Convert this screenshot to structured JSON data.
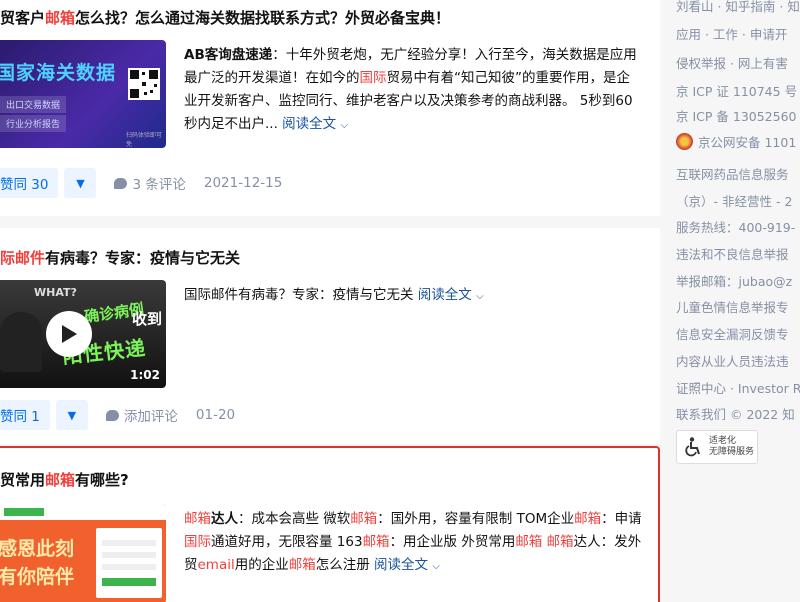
{
  "cards": [
    {
      "title_pre": "贸客户",
      "title_hl": "邮箱",
      "title_post": "怎么找？怎么通过海关数据找联系方式？外贸必备宝典！",
      "thumb_title": "国家海关数据",
      "thumb_line1": "出口交易数据",
      "thumb_line2": "行业分析报告",
      "thumb_qr_caption": "扫码体验即可免",
      "excerpt_bold": "AB客询盘速递",
      "excerpt_1": "：十年外贸老炮，无广经验分享！入行至今，海关数据是应用最广泛的开发渠道！在如今的",
      "excerpt_hl": "国际",
      "excerpt_2": "贸易中有着“知己知彼”的重要作用，是企业开发新客户、监控同行、维护老客户以及决策参考的商战利器。 5秒到60秒内足不出户...",
      "more": "阅读全文",
      "vote": "赞同 30",
      "comments": "3 条评论",
      "date": "2021-12-15"
    },
    {
      "title_hl": "际邮件",
      "title_post": "有病毒？专家：疫情与它无关",
      "video_what": "WHAT?",
      "video_text1": "确诊病例",
      "video_text2": "收到",
      "video_text3": "阳性快递",
      "video_duration": "1:02",
      "excerpt_1": "国际邮件有病毒？专家：疫情与它无关",
      "more": "阅读全文",
      "vote": "赞同 1",
      "comments": "添加评论",
      "date": "01-20"
    },
    {
      "title_pre": "贸常用",
      "title_hl": "邮箱",
      "title_post": "有哪些?",
      "thumb_text1": "感恩此刻",
      "thumb_text2": "有你陪伴",
      "ex_hl1": "邮箱",
      "ex_b1": "达人",
      "ex_1": "：成本会高些 微软",
      "ex_hl2": "邮箱",
      "ex_2": "：国外用，容量有限制 TOM企业",
      "ex_hl3": "邮箱",
      "ex_3": "：申请",
      "ex_hl4": "国际",
      "ex_4": "通道好用，无限容量 163",
      "ex_hl5": "邮箱",
      "ex_5": "：用企业版 外贸常用",
      "ex_hl6": "邮箱",
      "ex_6": " ",
      "ex_hl7": "邮箱",
      "ex_7": "达人：发外贸",
      "ex_hl8": "email",
      "ex_8": "用的企业",
      "ex_hl9": "邮箱",
      "ex_9": "怎么注册",
      "more": "阅读全文"
    }
  ],
  "sidebar": {
    "lines": [
      "刘看山 · 知乎指南 · 知",
      "应用 · 工作 · 申请开",
      "侵权举报 · 网上有害",
      "京 ICP 证 110745 号",
      "京 ICP 备 13052560",
      "京公网安备 1101",
      "互联网药品信息服务",
      "（京）- 非经营性 - 2",
      "服务热线：400-919-",
      "违法和不良信息举报",
      "举报邮箱：jubao@z",
      "儿童色情信息举报专",
      "信息安全漏洞反馈专",
      "内容从业人员违法违",
      "证照中心 · Investor R",
      "联系我们 © 2022 知"
    ],
    "elder_badge_line1": "适老化",
    "elder_badge_line2": "无障碍服务"
  },
  "colors": {
    "highlight": "#f1403c",
    "link": "#175199",
    "vote_bg": "#ebf4ff",
    "vote_fg": "#056de8",
    "selected_border": "#e0322c"
  }
}
